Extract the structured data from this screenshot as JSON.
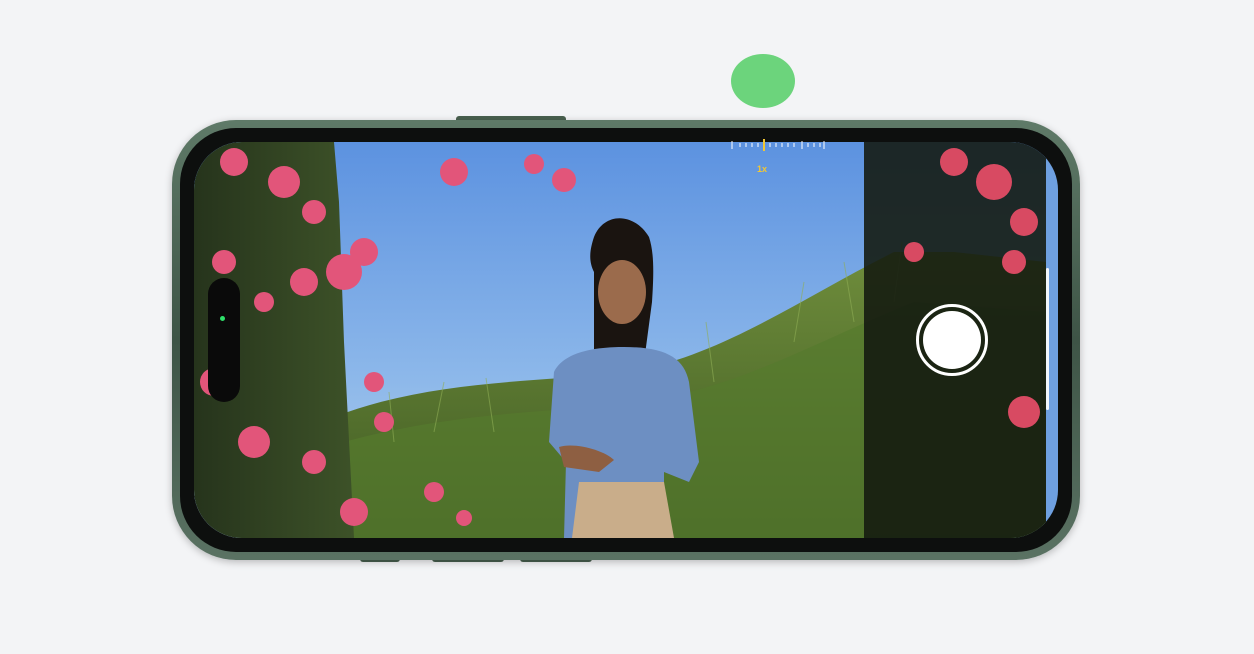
{
  "camera": {
    "zoom_label": "1x",
    "zoom_accent_color": "#f2c733",
    "shutter_button": "shutter-button",
    "status_led_color": "#2ee06a"
  },
  "decor": {
    "indicator_color": "#6cd47c",
    "phone_frame_color": "#3e5446"
  },
  "icons": [
    "shutter-icon",
    "zoom-dial-icon"
  ]
}
